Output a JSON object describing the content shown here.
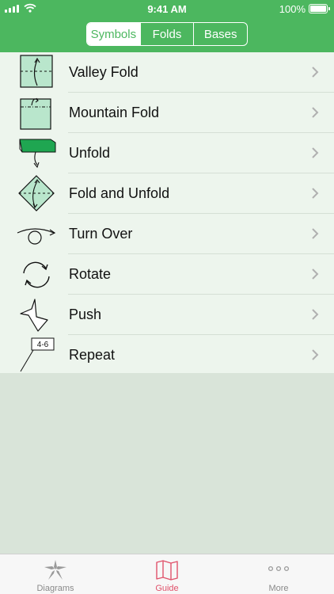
{
  "status_bar": {
    "time": "9:41 AM",
    "battery": "100%"
  },
  "segmented": {
    "tabs": [
      {
        "label": "Symbols",
        "active": true
      },
      {
        "label": "Folds",
        "active": false
      },
      {
        "label": "Bases",
        "active": false
      }
    ]
  },
  "list": {
    "items": [
      {
        "label": "Valley Fold",
        "icon": "valley-fold-icon"
      },
      {
        "label": "Mountain Fold",
        "icon": "mountain-fold-icon"
      },
      {
        "label": "Unfold",
        "icon": "unfold-icon"
      },
      {
        "label": "Fold and Unfold",
        "icon": "fold-and-unfold-icon"
      },
      {
        "label": "Turn Over",
        "icon": "turn-over-icon"
      },
      {
        "label": "Rotate",
        "icon": "rotate-icon"
      },
      {
        "label": "Push",
        "icon": "push-icon"
      },
      {
        "label": "Repeat",
        "icon": "repeat-icon",
        "badge": "4-6"
      }
    ]
  },
  "tab_bar": {
    "tabs": [
      {
        "label": "Diagrams",
        "icon": "crane-star-icon",
        "active": false
      },
      {
        "label": "Guide",
        "icon": "map-icon",
        "active": true
      },
      {
        "label": "More",
        "icon": "more-dots-icon",
        "active": false
      }
    ]
  },
  "colors": {
    "accent": "#4cb75f",
    "active_tab": "#e0526b",
    "list_bg": "#edf5ed",
    "empty_bg": "#d9e4d9"
  }
}
